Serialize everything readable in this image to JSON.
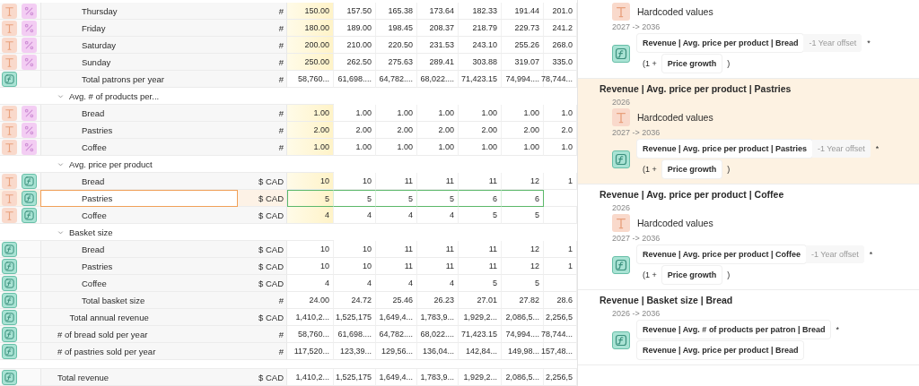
{
  "table": {
    "rows": [
      {
        "kind": "group",
        "children": [
          {
            "kind": "group",
            "children": [
              {
                "kind": "leaf",
                "label": "Thursday",
                "icons": [
                  {
                    "kind": "text"
                  },
                  {
                    "kind": "percent"
                  }
                ],
                "unit": "#",
                "selected": false,
                "values": [
                  "150.00",
                  "157.50",
                  "165.38",
                  "173.64",
                  "182.33",
                  "191.44",
                  "201.0"
                ]
              },
              {
                "kind": "leaf",
                "label": "Friday",
                "icons": [
                  {
                    "kind": "text"
                  },
                  {
                    "kind": "percent"
                  }
                ],
                "unit": "#",
                "selected": false,
                "values": [
                  "180.00",
                  "189.00",
                  "198.45",
                  "208.37",
                  "218.79",
                  "229.73",
                  "241.2"
                ]
              },
              {
                "kind": "leaf",
                "label": "Saturday",
                "icons": [
                  {
                    "kind": "text"
                  },
                  {
                    "kind": "percent"
                  }
                ],
                "unit": "#",
                "selected": false,
                "values": [
                  "200.00",
                  "210.00",
                  "220.50",
                  "231.53",
                  "243.10",
                  "255.26",
                  "268.0"
                ]
              },
              {
                "kind": "leaf",
                "label": "Sunday",
                "icons": [
                  {
                    "kind": "text"
                  },
                  {
                    "kind": "percent"
                  }
                ],
                "unit": "#",
                "selected": false,
                "values": [
                  "250.00",
                  "262.50",
                  "275.63",
                  "289.41",
                  "303.88",
                  "319.07",
                  "335.0"
                ]
              },
              {
                "kind": "leaf",
                "label": "Total patrons per year",
                "icons": [
                  {
                    "kind": "formula"
                  }
                ],
                "unit": "#",
                "selected": false,
                "values": [
                  "58,760...",
                  "61,698....",
                  "64,782....",
                  "68,022....",
                  "71,423.15",
                  "74,994....",
                  "78,744..."
                ]
              }
            ]
          },
          {
            "kind": "group",
            "label": "Avg. # of products per...",
            "expanded": true,
            "children": [
              {
                "kind": "leaf",
                "label": "Bread",
                "icons": [
                  {
                    "kind": "text"
                  },
                  {
                    "kind": "percent"
                  }
                ],
                "unit": "#",
                "selected": false,
                "values": [
                  "1.00",
                  "1.00",
                  "1.00",
                  "1.00",
                  "1.00",
                  "1.00",
                  "1.0"
                ]
              },
              {
                "kind": "leaf",
                "label": "Pastries",
                "icons": [
                  {
                    "kind": "text"
                  },
                  {
                    "kind": "percent"
                  }
                ],
                "unit": "#",
                "selected": false,
                "values": [
                  "2.00",
                  "2.00",
                  "2.00",
                  "2.00",
                  "2.00",
                  "2.00",
                  "2.0"
                ]
              },
              {
                "kind": "leaf",
                "label": "Coffee",
                "icons": [
                  {
                    "kind": "text"
                  },
                  {
                    "kind": "percent"
                  }
                ],
                "unit": "#",
                "selected": false,
                "values": [
                  "1.00",
                  "1.00",
                  "1.00",
                  "1.00",
                  "1.00",
                  "1.00",
                  "1.0"
                ]
              }
            ]
          },
          {
            "kind": "group",
            "label": "Avg. price per product",
            "expanded": true,
            "children": [
              {
                "kind": "leaf",
                "label": "Bread",
                "icons": [
                  {
                    "kind": "text"
                  },
                  {
                    "kind": "formula"
                  }
                ],
                "unit": "$ CAD",
                "selected": false,
                "values": [
                  "10",
                  "10",
                  "11",
                  "11",
                  "11",
                  "12",
                  "1"
                ]
              },
              {
                "kind": "leaf",
                "label": "Pastries",
                "icons": [
                  {
                    "kind": "text"
                  },
                  {
                    "kind": "formula"
                  }
                ],
                "unit": "$ CAD",
                "selected": true,
                "values": [
                  "5",
                  "5",
                  "5",
                  "5",
                  "6",
                  "6"
                ]
              },
              {
                "kind": "leaf",
                "label": "Coffee",
                "icons": [
                  {
                    "kind": "text"
                  },
                  {
                    "kind": "formula"
                  }
                ],
                "unit": "$ CAD",
                "selected": false,
                "values": [
                  "4",
                  "4",
                  "4",
                  "4",
                  "5",
                  "5"
                ]
              }
            ]
          },
          {
            "kind": "group",
            "label": "Basket size",
            "expanded": true,
            "children": [
              {
                "kind": "leaf",
                "label": "Bread",
                "icons": [
                  {
                    "kind": "formula"
                  }
                ],
                "unit": "$ CAD",
                "selected": false,
                "values": [
                  "10",
                  "10",
                  "11",
                  "11",
                  "11",
                  "12",
                  "1"
                ]
              },
              {
                "kind": "leaf",
                "label": "Pastries",
                "icons": [
                  {
                    "kind": "formula"
                  }
                ],
                "unit": "$ CAD",
                "selected": false,
                "values": [
                  "10",
                  "10",
                  "11",
                  "11",
                  "11",
                  "12",
                  "1"
                ]
              },
              {
                "kind": "leaf",
                "label": "Coffee",
                "icons": [
                  {
                    "kind": "formula"
                  }
                ],
                "unit": "$ CAD",
                "selected": false,
                "values": [
                  "4",
                  "4",
                  "4",
                  "4",
                  "5",
                  "5"
                ]
              },
              {
                "kind": "leaf",
                "label": "Total basket size",
                "icons": [
                  {
                    "kind": "formula"
                  }
                ],
                "unit": "#",
                "selected": false,
                "values": [
                  "24.00",
                  "24.72",
                  "25.46",
                  "26.23",
                  "27.01",
                  "27.82",
                  "28.6"
                ]
              }
            ]
          },
          {
            "kind": "leaf",
            "label": "Total annual revenue",
            "icons": [
              {
                "kind": "formula"
              }
            ],
            "unit": "$ CAD",
            "selected": false,
            "values": [
              "1,410,2...",
              "1,525,175",
              "1,649,4...",
              "1,783,9...",
              "1,929,2...",
              "2,086,5...",
              "2,256,5"
            ]
          }
        ]
      },
      {
        "kind": "leaf",
        "label": "# of bread sold per year",
        "icons": [
          {
            "kind": "formula"
          }
        ],
        "unit": "#",
        "selected": false,
        "values": [
          "58,760...",
          "61,698....",
          "64,782....",
          "68,022....",
          "71,423.15",
          "74,994....",
          "78,744..."
        ]
      },
      {
        "kind": "leaf",
        "label": "# of pastries sold per year",
        "icons": [
          {
            "kind": "formula"
          }
        ],
        "unit": "#",
        "selected": false,
        "values": [
          "117,520...",
          "123,39...",
          "129,56...",
          "136,04...",
          "142,84...",
          "149,98...",
          "157,48..."
        ]
      },
      {
        "kind": "total",
        "label": "Total revenue",
        "icons": [
          {
            "kind": "formula"
          }
        ],
        "unit": "$ CAD",
        "selected": false,
        "values": [
          "1,410,2...",
          "1,525,175",
          "1,649,4...",
          "1,783,9...",
          "1,929,2...",
          "2,086,5...",
          "2,256,5"
        ]
      }
    ]
  },
  "details": {
    "sections": [
      {
        "selected": false,
        "periods": [
          {
            "kind": "hardcoded",
            "text": "Hardcoded values"
          },
          {
            "kind": "formula",
            "range": "2027 -> 2036",
            "lines": [
              [
                {
                  "kind": "ref",
                  "text": "Revenue | Avg. price per product | Bread"
                },
                {
                  "kind": "offset",
                  "text": "-1 Year offset"
                },
                {
                  "kind": "op",
                  "text": "*"
                }
              ],
              [
                {
                  "kind": "op",
                  "text": "(1 +"
                },
                {
                  "kind": "ref",
                  "text": "Price growth"
                },
                {
                  "kind": "op",
                  "text": ")"
                }
              ]
            ]
          }
        ]
      },
      {
        "title": "Revenue | Avg. price per product | Pastries",
        "selected": true,
        "periods": [
          {
            "kind": "hardcoded",
            "range": "2026",
            "text": "Hardcoded values"
          },
          {
            "kind": "formula",
            "range": "2027 -> 2036",
            "lines": [
              [
                {
                  "kind": "ref",
                  "text": "Revenue | Avg. price per product | Pastries"
                },
                {
                  "kind": "offset",
                  "text": "-1 Year offset"
                },
                {
                  "kind": "op",
                  "text": "*"
                }
              ],
              [
                {
                  "kind": "op",
                  "text": "(1 +"
                },
                {
                  "kind": "ref",
                  "text": "Price growth"
                },
                {
                  "kind": "op",
                  "text": ")"
                }
              ]
            ]
          }
        ]
      },
      {
        "title": "Revenue | Avg. price per product | Coffee",
        "selected": false,
        "periods": [
          {
            "kind": "hardcoded",
            "range": "2026",
            "text": "Hardcoded values"
          },
          {
            "kind": "formula",
            "range": "2027 -> 2036",
            "lines": [
              [
                {
                  "kind": "ref",
                  "text": "Revenue | Avg. price per product | Coffee"
                },
                {
                  "kind": "offset",
                  "text": "-1 Year offset"
                },
                {
                  "kind": "op",
                  "text": "*"
                }
              ],
              [
                {
                  "kind": "op",
                  "text": "(1 +"
                },
                {
                  "kind": "ref",
                  "text": "Price growth"
                },
                {
                  "kind": "op",
                  "text": ")"
                }
              ]
            ]
          }
        ]
      },
      {
        "title": "Revenue | Basket size | Bread",
        "selected": false,
        "periods": [
          {
            "kind": "formula",
            "range": "2026 -> 2036",
            "lines": [
              [
                {
                  "kind": "ref",
                  "text": "Revenue | Avg. # of products per patron | Bread"
                },
                {
                  "kind": "op",
                  "text": "*"
                }
              ],
              [
                {
                  "kind": "ref",
                  "text": "Revenue | Avg. price per product | Bread"
                }
              ]
            ]
          }
        ]
      }
    ]
  }
}
